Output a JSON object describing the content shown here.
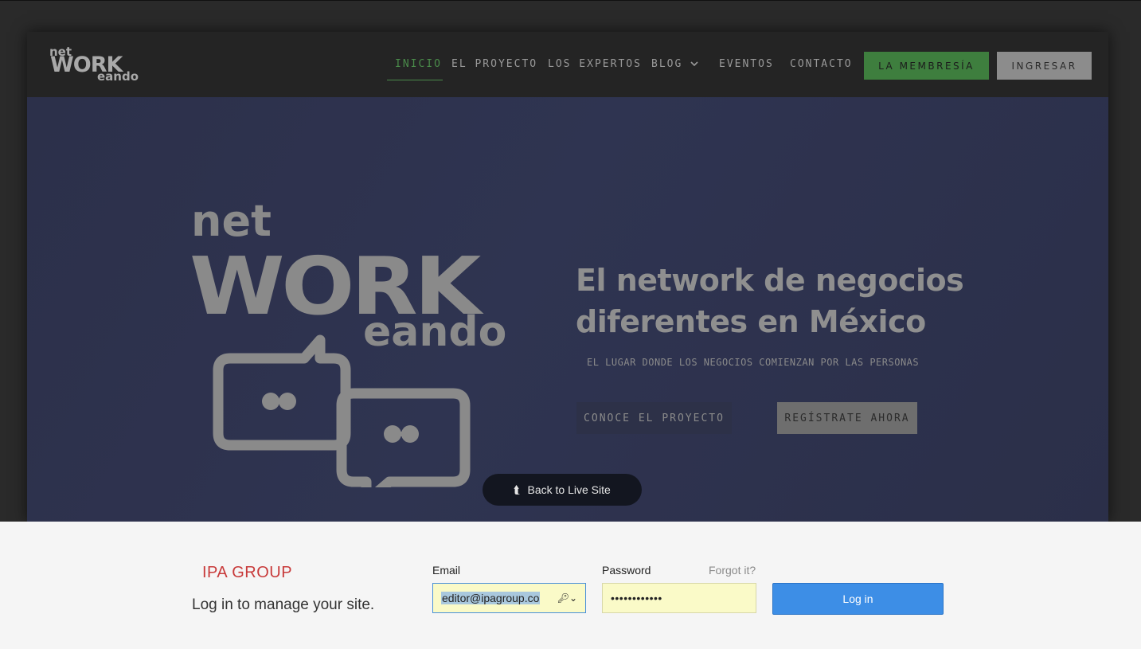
{
  "site": {
    "logo": {
      "line1": "net",
      "line2": "WORK",
      "line3": "eando"
    },
    "nav": {
      "items": [
        {
          "label": "INICIO"
        },
        {
          "label": "EL PROYECTO"
        },
        {
          "label": "LOS EXPERTOS"
        },
        {
          "label": "BLOG"
        },
        {
          "label": "EVENTOS"
        },
        {
          "label": "CONTACTO"
        }
      ],
      "membership_button": "LA MEMBRESÍA",
      "login_button": "INGRESAR"
    },
    "hero": {
      "logo": {
        "line1": "net",
        "line2": "WORK",
        "line3": "eando"
      },
      "title_line1": "El network de negocios",
      "title_line2": "diferentes en México",
      "subtitle": "EL LUGAR DONDE LOS NEGOCIOS COMIENZAN POR LAS PERSONAS",
      "primary_button": "CONOCE EL PROYECTO",
      "secondary_button": "REGÍSTRATE AHORA"
    }
  },
  "back_to_live": {
    "label": "Back to Live Site",
    "icon": "back-arrow-icon"
  },
  "login": {
    "brand": "IPA GROUP",
    "tagline": "Log in to manage your site.",
    "email_label": "Email",
    "email_value": "editor@ipagroup.co",
    "password_label": "Password",
    "password_value": "••••••••••••",
    "forgot_link": "Forgot it?",
    "submit_button": "Log in"
  },
  "colors": {
    "accent_green": "#3e7e3e",
    "active_nav": "#4a8b4a",
    "hero_bg": "#2f3451",
    "login_button": "#3d8ee6",
    "brand_red": "#c83a3a",
    "autofill_yellow": "#fafac8"
  }
}
